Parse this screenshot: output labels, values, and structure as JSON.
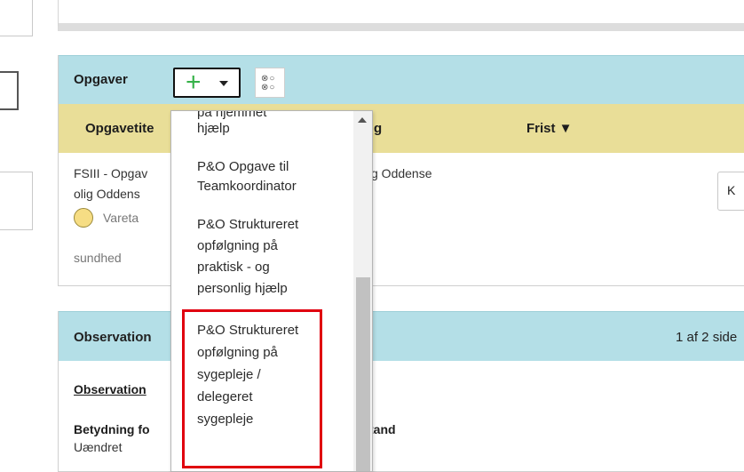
{
  "opgaver": {
    "title": "Opgaver",
    "add_icon": "plus-icon",
    "caret_icon": "caret-down-icon",
    "toggle_icon": "checklist-toggle-icon",
    "toggle_glyphs": [
      "⊗○",
      "⊗○"
    ],
    "columns": [
      "Opgavetite",
      "g",
      "Frist ▼"
    ],
    "row": {
      "title_lines": [
        "FSIII - Opgav",
        "olig Oddens"
      ],
      "middle_fragment": "g Oddense",
      "status_label": "Vareta",
      "status_extra": "sundhed",
      "right_button_label": "K"
    }
  },
  "observationer": {
    "title": "Observation",
    "pages": "1 af 2 side",
    "section_label": "Observation",
    "field_label": "Betydning fo",
    "field_label_tail": "tand",
    "field_value": "Uændret"
  },
  "dropdown": {
    "items": [
      {
        "lines": [
          "på hjemmet",
          "hjælp"
        ]
      },
      {
        "lines": [
          "P&O Opgave til",
          "Teamkoordinator"
        ]
      },
      {
        "lines": [
          "P&O Struktureret",
          "opfølgning på",
          "praktisk - og",
          "personlig hjælp"
        ]
      },
      {
        "lines": [
          "P&O Struktureret",
          "opfølgning på",
          "sygepleje /",
          "delegeret",
          "sygepleje"
        ]
      }
    ]
  },
  "colors": {
    "panel_header": "#b4dfe7",
    "table_header": "#e9de98",
    "highlight": "#e0000f",
    "add_icon": "#37b24a"
  }
}
